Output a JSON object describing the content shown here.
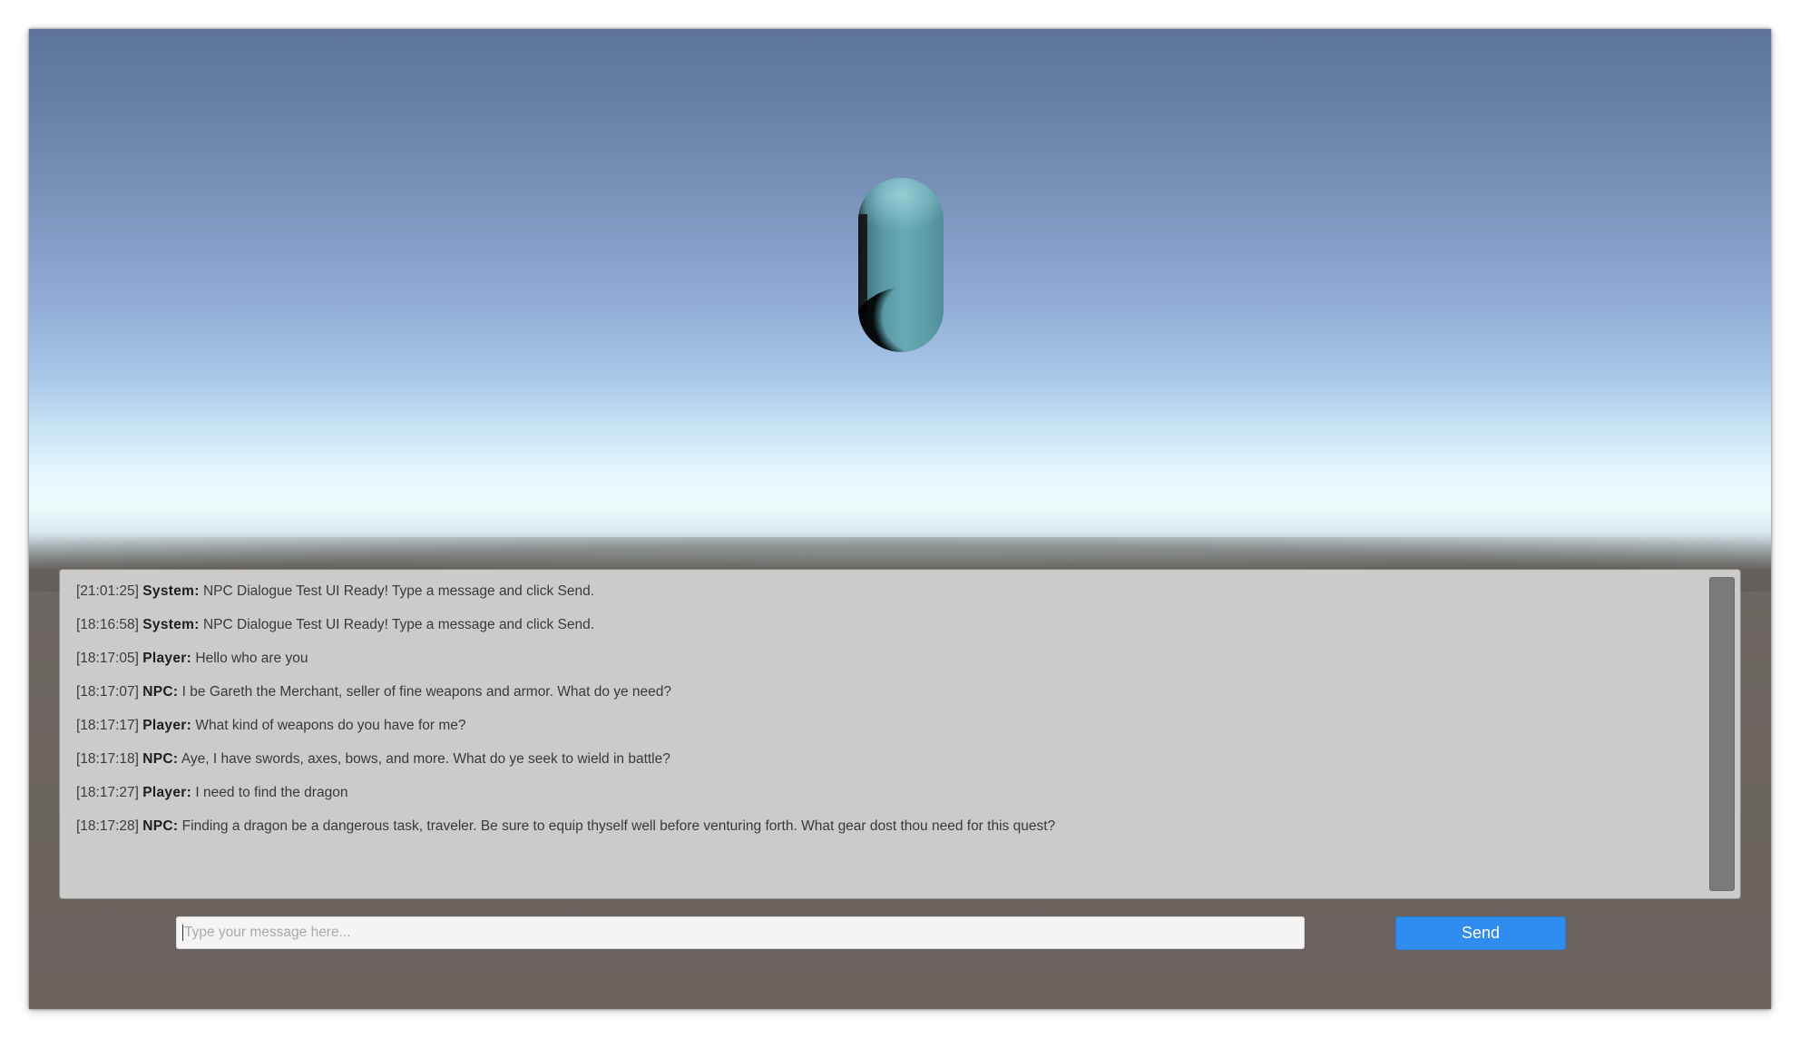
{
  "scene": {
    "colors": {
      "sky_top": "#5d7399",
      "sky_horizon": "#eefbfd",
      "ground": "#6b645f",
      "capsule": "#67a9b4"
    }
  },
  "chat": {
    "messages": [
      {
        "time": "[21:01:25]",
        "speaker": "System:",
        "text": "NPC Dialogue Test UI Ready! Type a message and click Send."
      },
      {
        "time": "[18:16:58]",
        "speaker": "System:",
        "text": "NPC Dialogue Test UI Ready! Type a message and click Send."
      },
      {
        "time": "[18:17:05]",
        "speaker": "Player:",
        "text": "Hello who are you"
      },
      {
        "time": "[18:17:07]",
        "speaker": "NPC:",
        "text": "I be Gareth the Merchant, seller of fine weapons and armor. What do ye need?"
      },
      {
        "time": "[18:17:17]",
        "speaker": "Player:",
        "text": "What kind of weapons do you have for me?"
      },
      {
        "time": "[18:17:18]",
        "speaker": "NPC:",
        "text": "Aye, I have swords, axes, bows, and more. What do ye seek to wield in battle?"
      },
      {
        "time": "[18:17:27]",
        "speaker": "Player:",
        "text": "I need to find the dragon"
      },
      {
        "time": "[18:17:28]",
        "speaker": "NPC:",
        "text": "Finding a dragon be a dangerous task, traveler. Be sure to equip thyself well before venturing forth. What gear dost thou need for this quest?"
      }
    ],
    "panel_color": "#cbcbcb"
  },
  "input": {
    "placeholder": "Type your message here...",
    "value": ""
  },
  "send": {
    "label": "Send",
    "color": "#2f8cf0"
  }
}
